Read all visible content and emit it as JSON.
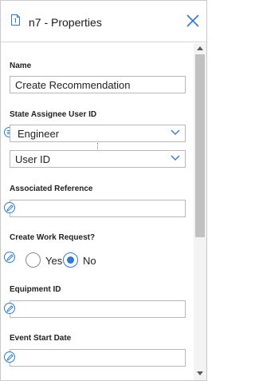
{
  "header": {
    "title": "n7 - Properties"
  },
  "fields": {
    "name": {
      "label": "Name",
      "value": "Create Recommendation"
    },
    "state_assignee": {
      "label": "State Assignee User ID",
      "primary_value": "Engineer",
      "secondary_value": "User ID"
    },
    "associated_reference": {
      "label": "Associated Reference",
      "value": ""
    },
    "create_work_request": {
      "label": "Create Work Request?",
      "options": [
        {
          "label": "Yes",
          "checked": false
        },
        {
          "label": "No",
          "checked": true
        }
      ]
    },
    "equipment_id": {
      "label": "Equipment ID",
      "value": ""
    },
    "event_start_date": {
      "label": "Event Start Date",
      "value": ""
    }
  },
  "colors": {
    "accent": "#2f7ad1",
    "border": "#b7b7b7",
    "scroll_thumb": "#c1c1c1"
  }
}
